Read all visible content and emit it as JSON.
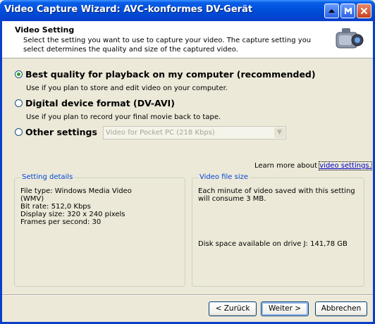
{
  "window": {
    "title": "Video Capture Wizard: AVC-konformes DV-Gerät"
  },
  "header": {
    "title": "Video Setting",
    "description": "Select the setting you want to use to capture your video. The capture setting you select determines the quality and size of the captured video."
  },
  "options": [
    {
      "label": "Best quality for playback on my computer (recommended)",
      "sub": "Use if you plan to store and edit video on your computer.",
      "selected": true
    },
    {
      "label": "Digital device format (DV-AVI)",
      "sub": "Use if you plan to record your final movie back to tape.",
      "selected": false
    },
    {
      "label": "Other settings",
      "selected": false
    }
  ],
  "other_settings_select": {
    "value": "Video for Pocket PC (218 Kbps)"
  },
  "learn_more": {
    "prefix": "Learn more about",
    "link": "video settings."
  },
  "setting_details": {
    "legend": "Setting details",
    "text": "File type: Windows Media Video\n(WMV)\nBit rate: 512,0 Kbps\nDisplay size: 320 x 240 pixels\nFrames per second: 30"
  },
  "video_file_size": {
    "legend": "Video file size",
    "text": "Each minute of video saved with this setting\nwill consume 3 MB.",
    "disk": "Disk space available on drive J: 141,78 GB"
  },
  "buttons": {
    "back": "< Zurück",
    "next": "Weiter >",
    "cancel": "Abbrechen"
  }
}
